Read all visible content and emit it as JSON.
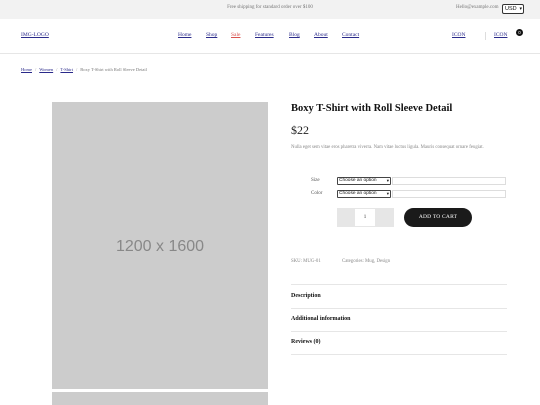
{
  "topbar": {
    "promo": "Free shipping for standard order over $100",
    "email": "Hello@example.com",
    "currency": "USD"
  },
  "header": {
    "logo": "IMG-LOGO",
    "nav": [
      "Home",
      "Shop",
      "Sale",
      "Features",
      "Blog",
      "About",
      "Contact"
    ],
    "active_nav": "Sale",
    "active_color": "#d9534f",
    "search_icon": "ICON",
    "cart_icon": "ICON",
    "cart_count": "0"
  },
  "breadcrumb": [
    "Home",
    "Women",
    "T-Shirt",
    "Boxy T-Shirt with Roll Sleeve Detail"
  ],
  "product": {
    "image_placeholder": "1200 x 1600",
    "title": "Boxy T-Shirt with Roll Sleeve Detail",
    "price": "$22",
    "description": "Nulla eget sem vitae eros pharetra viverra. Nam vitae luctus ligula. Mauris consequat ornare feugiat.",
    "variations": [
      {
        "label": "Size",
        "selected": "Choose an option"
      },
      {
        "label": "Color",
        "selected": "Choose an option"
      }
    ],
    "quantity": "1",
    "add_to_cart": "ADD TO CART",
    "sku": "SKU: MUG-01",
    "categories": "Categories: Mug, Design"
  },
  "tabs": [
    "Description",
    "Additional information",
    "Reviews (0)"
  ]
}
